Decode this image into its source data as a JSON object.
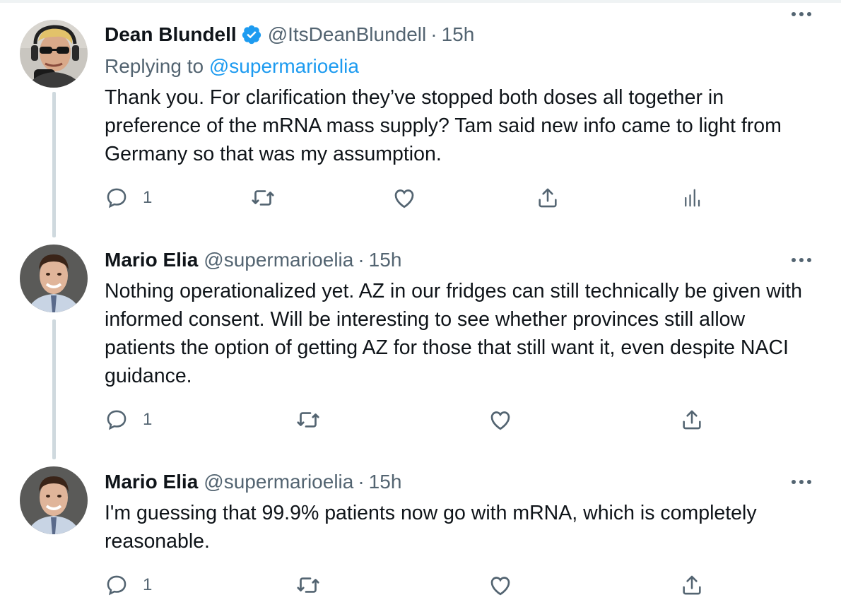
{
  "tweets": [
    {
      "name": "Dean Blundell",
      "verified": true,
      "handle": "@ItsDeanBlundell",
      "separator": "·",
      "time": "15h",
      "replying_prefix": "Replying to ",
      "replying_to": "@supermarioelia",
      "body": "Thank you.  For clarification they’ve stopped both doses all together in preference of the mRNA mass supply?  Tam said new info came to light from Germany so that was my assumption.",
      "reply_count": "1"
    },
    {
      "name": "Mario Elia",
      "verified": false,
      "handle": "@supermarioelia",
      "separator": "·",
      "time": "15h",
      "body": "Nothing operationalized yet. AZ in our fridges can still technically be given with informed consent. Will be interesting to see whether provinces still allow patients the option of getting AZ for those that still want it, even despite NACI guidance.",
      "reply_count": "1"
    },
    {
      "name": "Mario Elia",
      "verified": false,
      "handle": "@supermarioelia",
      "separator": "·",
      "time": "15h",
      "body": "I'm guessing that 99.9% patients now go with mRNA, which is completely reasonable.",
      "reply_count": "1"
    }
  ],
  "icons": {
    "reply": "reply-icon",
    "retweet": "retweet-icon",
    "like": "like-icon",
    "share": "share-icon",
    "analytics": "analytics-icon",
    "more": "more-icon",
    "verified": "verified-badge-icon"
  },
  "colors": {
    "accent": "#1d9bf0",
    "secondary_text": "#536471",
    "thread_line": "#cfd9de"
  }
}
